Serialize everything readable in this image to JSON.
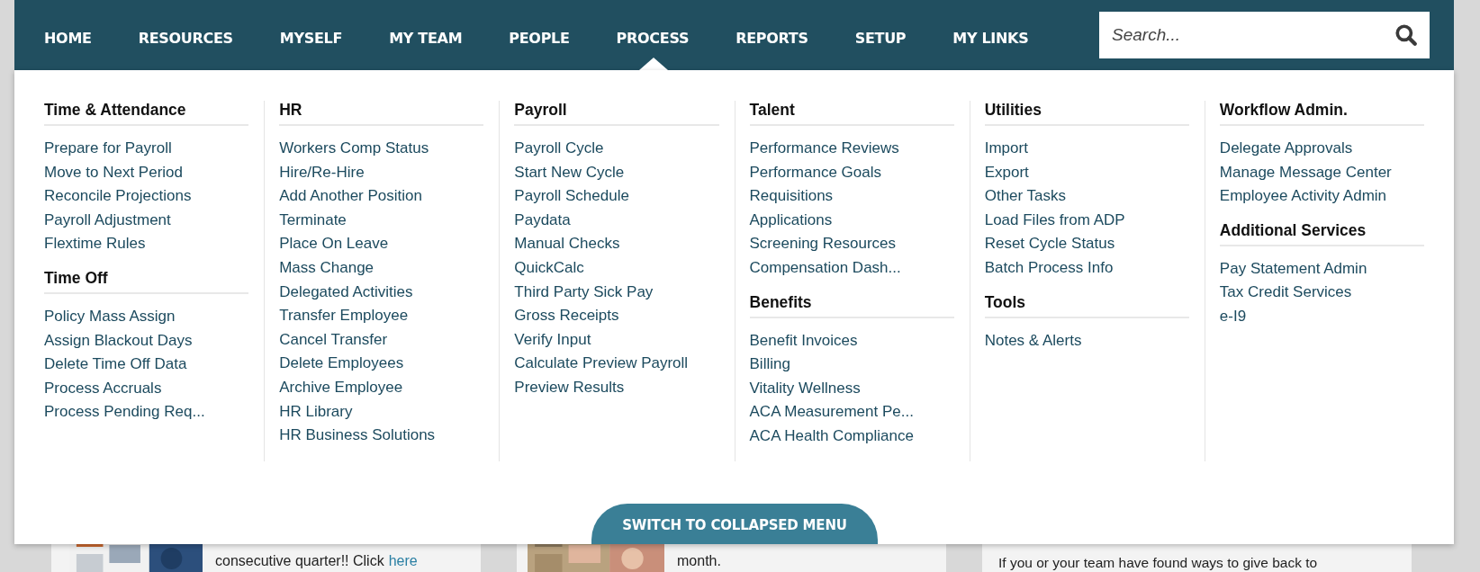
{
  "nav": {
    "items": [
      {
        "label": "HOME",
        "selected": false
      },
      {
        "label": "RESOURCES",
        "selected": false
      },
      {
        "label": "MYSELF",
        "selected": false
      },
      {
        "label": "MY TEAM",
        "selected": false
      },
      {
        "label": "PEOPLE",
        "selected": false
      },
      {
        "label": "PROCESS",
        "selected": true
      },
      {
        "label": "REPORTS",
        "selected": false
      },
      {
        "label": "SETUP",
        "selected": false
      },
      {
        "label": "MY LINKS",
        "selected": false
      }
    ]
  },
  "search": {
    "placeholder": "Search..."
  },
  "menu": {
    "columns": [
      {
        "sections": [
          {
            "heading": "Time & Attendance",
            "links": [
              "Prepare for Payroll",
              "Move to Next Period",
              "Reconcile Projections",
              "Payroll Adjustment",
              "Flextime Rules"
            ]
          },
          {
            "heading": "Time Off",
            "links": [
              "Policy Mass Assign",
              "Assign Blackout Days",
              "Delete Time Off Data",
              "Process Accruals",
              "Process Pending Req..."
            ]
          }
        ]
      },
      {
        "sections": [
          {
            "heading": "HR",
            "links": [
              "Workers Comp Status",
              "Hire/Re-Hire",
              "Add Another Position",
              "Terminate",
              "Place On Leave",
              "Mass Change",
              "Delegated Activities",
              "Transfer Employee",
              "Cancel Transfer",
              "Delete Employees",
              "Archive Employee",
              "HR Library",
              "HR Business Solutions"
            ]
          }
        ]
      },
      {
        "sections": [
          {
            "heading": "Payroll",
            "links": [
              "Payroll Cycle",
              "Start New Cycle",
              "Payroll Schedule",
              "Paydata",
              "Manual Checks",
              "QuickCalc",
              "Third Party Sick Pay",
              "Gross Receipts",
              "Verify Input",
              "Calculate Preview Payroll",
              "Preview Results"
            ]
          }
        ]
      },
      {
        "sections": [
          {
            "heading": "Talent",
            "links": [
              "Performance Reviews",
              "Performance Goals",
              "Requisitions",
              "Applications",
              "Screening Resources",
              "Compensation Dash..."
            ]
          },
          {
            "heading": "Benefits",
            "links": [
              "Benefit Invoices",
              "Billing",
              "Vitality Wellness",
              "ACA Measurement Pe...",
              "ACA Health Compliance"
            ]
          }
        ]
      },
      {
        "sections": [
          {
            "heading": "Utilities",
            "links": [
              "Import",
              "Export",
              "Other Tasks",
              "Load Files from ADP",
              "Reset Cycle Status",
              "Batch Process Info"
            ]
          },
          {
            "heading": "Tools",
            "links": [
              "Notes & Alerts"
            ]
          }
        ]
      },
      {
        "sections": [
          {
            "heading": "Workflow Admin.",
            "links": [
              "Delegate Approvals",
              "Manage Message Center",
              "Employee Activity Admin"
            ]
          },
          {
            "heading": "Additional Services",
            "links": [
              "Pay Statement Admin",
              "Tax Credit Services",
              "e-I9"
            ]
          }
        ]
      }
    ]
  },
  "collapse_button": {
    "label": "SWITCH TO COLLAPSED MENU"
  },
  "background_cards": [
    {
      "kind": "picture",
      "text": "consecutive quarter!! Click",
      "link": "here"
    },
    {
      "kind": "picture",
      "text": "month."
    },
    {
      "kind": "text",
      "text": "If you or your team have found ways to give back to"
    }
  ]
}
